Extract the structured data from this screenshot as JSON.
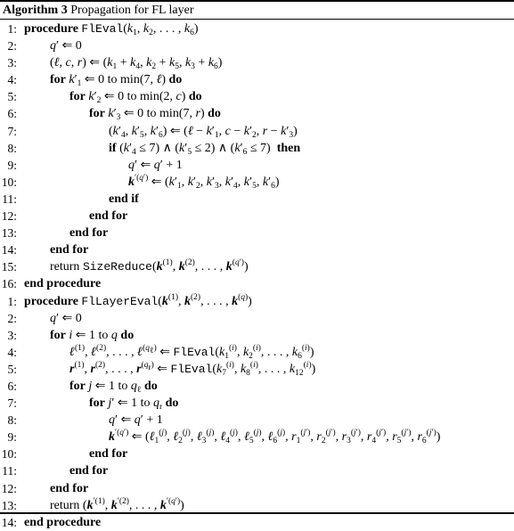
{
  "caption": {
    "label": "Algorithm 3",
    "title": "Propagation for FL layer"
  },
  "procedures": [
    {
      "name": "FlEval",
      "lines": [
        {
          "num": "1:",
          "indent": 0,
          "html": "<span class=\"kw\">procedure</span> <span class=\"tt\">FlEval</span>(<span class=\"m\">k</span><sub>1</sub>, <span class=\"m\">k</span><sub>2</sub>, . . . , <span class=\"m\">k</span><sub>6</sub>)"
        },
        {
          "num": "2:",
          "indent": 1,
          "html": "<span class=\"m\">q</span>′ ⇐ 0"
        },
        {
          "num": "3:",
          "indent": 1,
          "html": "(<span class=\"m\">ℓ</span>, <span class=\"m\">c</span>, <span class=\"m\">r</span>) ⇐ (<span class=\"m\">k</span><sub>1</sub> + <span class=\"m\">k</span><sub>4</sub>, <span class=\"m\">k</span><sub>2</sub> + <span class=\"m\">k</span><sub>5</sub>, <span class=\"m\">k</span><sub>3</sub> + <span class=\"m\">k</span><sub>6</sub>)"
        },
        {
          "num": "4:",
          "indent": 1,
          "html": "<span class=\"kw\">for</span> <span class=\"m\">k</span>′<sub>1</sub> ⇐ 0 to min(7, <span class=\"m\">ℓ</span>) <span class=\"kw\">do</span>"
        },
        {
          "num": "5:",
          "indent": 2,
          "html": "<span class=\"kw\">for</span> <span class=\"m\">k</span>′<sub>2</sub> ⇐ 0 to min(2, <span class=\"m\">c</span>) <span class=\"kw\">do</span>"
        },
        {
          "num": "6:",
          "indent": 3,
          "html": "<span class=\"kw\">for</span> <span class=\"m\">k</span>′<sub>3</sub> ⇐ 0 to min(7, <span class=\"m\">r</span>) <span class=\"kw\">do</span>"
        },
        {
          "num": "7:",
          "indent": 4,
          "html": "(<span class=\"m\">k</span>′<sub>4</sub>, <span class=\"m\">k</span>′<sub>5</sub>, <span class=\"m\">k</span>′<sub>6</sub>) ⇐ (<span class=\"m\">ℓ</span> − <span class=\"m\">k</span>′<sub>1</sub>, <span class=\"m\">c</span> − <span class=\"m\">k</span>′<sub>2</sub>, <span class=\"m\">r</span> − <span class=\"m\">k</span>′<sub>3</sub>)"
        },
        {
          "num": "8:",
          "indent": 4,
          "html": "<span class=\"kw\">if</span> (<span class=\"m\">k</span>′<sub>4</sub> ≤ 7) ∧ (<span class=\"m\">k</span>′<sub>5</sub> ≤ 2) ∧ (<span class=\"m\">k</span>′<sub>6</sub> ≤ 7) &nbsp;<span class=\"kw\">then</span>"
        },
        {
          "num": "9:",
          "indent": 5,
          "html": "<span class=\"m\">q</span>′ ⇐ <span class=\"m\">q</span>′ + 1"
        },
        {
          "num": "10:",
          "indent": 5,
          "html": "<span class=\"bv\">k</span><sup>′(<span class=\"m\">q</span>′)</sup> ⇐ (<span class=\"m\">k</span>′<sub>1</sub>, <span class=\"m\">k</span>′<sub>2</sub>, <span class=\"m\">k</span>′<sub>3</sub>, <span class=\"m\">k</span>′<sub>4</sub>, <span class=\"m\">k</span>′<sub>5</sub>, <span class=\"m\">k</span>′<sub>6</sub>)"
        },
        {
          "num": "11:",
          "indent": 4,
          "html": "<span class=\"kw\">end if</span>"
        },
        {
          "num": "12:",
          "indent": 3,
          "html": "<span class=\"kw\">end for</span>"
        },
        {
          "num": "13:",
          "indent": 2,
          "html": "<span class=\"kw\">end for</span>"
        },
        {
          "num": "14:",
          "indent": 1,
          "html": "<span class=\"kw\">end for</span>"
        },
        {
          "num": "15:",
          "indent": 1,
          "html": "return <span class=\"tt\">SizeReduce</span>(<span class=\"bv\">k</span><sup>(1)</sup>, <span class=\"bv\">k</span><sup>(2)</sup>, . . . , <span class=\"bv\">k</span><sup>(<span class=\"m\">q</span>′)</sup>)"
        },
        {
          "num": "16:",
          "indent": 0,
          "html": "<span class=\"kw\">end procedure</span>"
        }
      ]
    },
    {
      "name": "FlLayerEval",
      "lines": [
        {
          "num": "1:",
          "indent": 0,
          "html": "<span class=\"kw\">procedure</span> <span class=\"tt\">FlLayerEval</span>(<span class=\"bv\">k</span><sup>(1)</sup>, <span class=\"bv\">k</span><sup>(2)</sup>, . . . , <span class=\"bv\">k</span><sup>(<span class=\"m\">q</span>)</sup>)"
        },
        {
          "num": "2:",
          "indent": 1,
          "html": "<span class=\"m\">q</span>′ ⇐ 0"
        },
        {
          "num": "3:",
          "indent": 1,
          "html": "<span class=\"kw\">for</span> <span class=\"m\">i</span> ⇐ 1 to <span class=\"m\">q</span> <span class=\"kw\">do</span>"
        },
        {
          "num": "4:",
          "indent": 2,
          "html": "<span class=\"bv\">ℓ</span><sup>(1)</sup>, <span class=\"bv\">ℓ</span><sup>(2)</sup>, . . . , <span class=\"bv\">ℓ</span><sup>(<span class=\"m\">q</span><sub>ℓ</sub>)</sup> ⇐ <span class=\"tt\">FlEval</span>(<span class=\"m\">k</span><sub>1</sub><sup>(<span class=\"m\">i</span>)</sup>, <span class=\"m\">k</span><sub>2</sub><sup>(<span class=\"m\">i</span>)</sup>, . . . , <span class=\"m\">k</span><sub>6</sub><sup>(<span class=\"m\">i</span>)</sup>)"
        },
        {
          "num": "5:",
          "indent": 2,
          "html": "<span class=\"bv\">r</span><sup>(1)</sup>, <span class=\"bv\">r</span><sup>(2)</sup>, . . . , <span class=\"bv\">r</span><sup>(<span class=\"m\">q</span><sub>r</sub>)</sup> ⇐ <span class=\"tt\">FlEval</span>(<span class=\"m\">k</span><sub>7</sub><sup>(<span class=\"m\">i</span>)</sup>, <span class=\"m\">k</span><sub>8</sub><sup>(<span class=\"m\">i</span>)</sup>, . . . , <span class=\"m\">k</span><sub>12</sub><sup>(<span class=\"m\">i</span>)</sup>)"
        },
        {
          "num": "6:",
          "indent": 2,
          "html": "<span class=\"kw\">for</span> <span class=\"m\">j</span> ⇐ 1 to <span class=\"m\">q</span><sub>ℓ</sub> <span class=\"kw\">do</span>"
        },
        {
          "num": "7:",
          "indent": 3,
          "html": "<span class=\"kw\">for</span> <span class=\"m\">j</span>′ ⇐ 1 to <span class=\"m\">q</span><sub>r</sub> <span class=\"kw\">do</span>"
        },
        {
          "num": "8:",
          "indent": 4,
          "html": "<span class=\"m\">q</span>′ ⇐ <span class=\"m\">q</span>′ + 1"
        },
        {
          "num": "9:",
          "indent": 4,
          "html": "<span class=\"bv\">k</span><sup>′(<span class=\"m\">q</span>′)</sup> ⇐ (<span class=\"m\">ℓ</span><sub>1</sub><sup>(<span class=\"m\">j</span>)</sup>, <span class=\"m\">ℓ</span><sub>2</sub><sup>(<span class=\"m\">j</span>)</sup>, <span class=\"m\">ℓ</span><sub>3</sub><sup>(<span class=\"m\">j</span>)</sup>, <span class=\"m\">ℓ</span><sub>4</sub><sup>(<span class=\"m\">j</span>)</sup>, <span class=\"m\">ℓ</span><sub>5</sub><sup>(<span class=\"m\">j</span>)</sup>, <span class=\"m\">ℓ</span><sub>6</sub><sup>(<span class=\"m\">j</span>)</sup>, <span class=\"m\">r</span><sub>1</sub><sup>(<span class=\"m\">j</span>′)</sup>, <span class=\"m\">r</span><sub>2</sub><sup>(<span class=\"m\">j</span>′)</sup>, <span class=\"m\">r</span><sub>3</sub><sup>(<span class=\"m\">j</span>′)</sup>, <span class=\"m\">r</span><sub>4</sub><sup>(<span class=\"m\">j</span>′)</sup>, <span class=\"m\">r</span><sub>5</sub><sup>(<span class=\"m\">j</span>′)</sup>, <span class=\"m\">r</span><sub>6</sub><sup>(<span class=\"m\">j</span>′)</sup>)"
        },
        {
          "num": "10:",
          "indent": 3,
          "html": "<span class=\"kw\">end for</span>"
        },
        {
          "num": "11:",
          "indent": 2,
          "html": "<span class=\"kw\">end for</span>"
        },
        {
          "num": "12:",
          "indent": 1,
          "html": "<span class=\"kw\">end for</span>"
        },
        {
          "num": "13:",
          "indent": 1,
          "html": "return (<span class=\"bv\">k</span><sup>′(1)</sup>, <span class=\"bv\">k</span><sup>′(2)</sup>, . . . , <span class=\"bv\">k</span><sup>′(<span class=\"m\">q</span>′)</sup>)"
        },
        {
          "num": "14:",
          "indent": 0,
          "html": "<span class=\"kw\">end procedure</span>"
        }
      ]
    }
  ]
}
